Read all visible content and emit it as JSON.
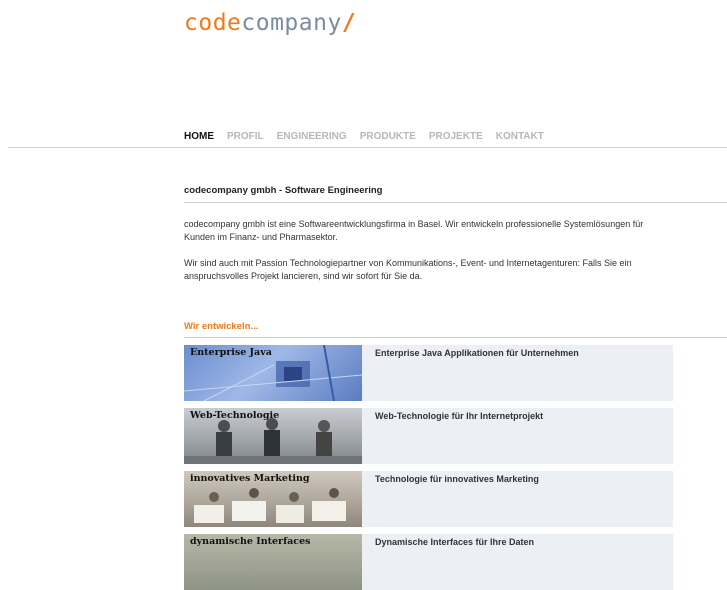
{
  "logo": {
    "part1": "code",
    "part2": "company",
    "slash": "/"
  },
  "nav": {
    "items": [
      "HOME",
      "PROFIL",
      "ENGINEERING",
      "PRODUKTE",
      "PROJEKTE",
      "KONTAKT"
    ],
    "active": "HOME"
  },
  "intro": {
    "title": "codecompany gmbh - Software Engineering",
    "para1": "codecompany gmbh ist eine Softwareentwicklungsfirma in Basel. Wir entwickeln professionelle Systemlösungen für Kunden im Finanz- und Pharmasektor.",
    "para2": "Wir sind auch mit Passion Technologiepartner von Kommunikations-, Event- und Internetagenturen: Falls Sie ein anspruchsvolles Projekt lancieren, sind wir sofort für Sie da."
  },
  "develop": {
    "title": "Wir entwickeln...",
    "title_color": "#f07a1a",
    "items": [
      {
        "image_label": "Enterprise Java",
        "text": "Enterprise Java Applikationen für Unternehmen"
      },
      {
        "image_label": "Web-Technologie",
        "text": "Web-Technologie für Ihr Internetprojekt"
      },
      {
        "image_label": "innovatives Marketing",
        "text": "Technologie für innovatives Marketing"
      },
      {
        "image_label": "dynamische Interfaces",
        "text": "Dynamische Interfaces für Ihre Daten"
      }
    ]
  }
}
